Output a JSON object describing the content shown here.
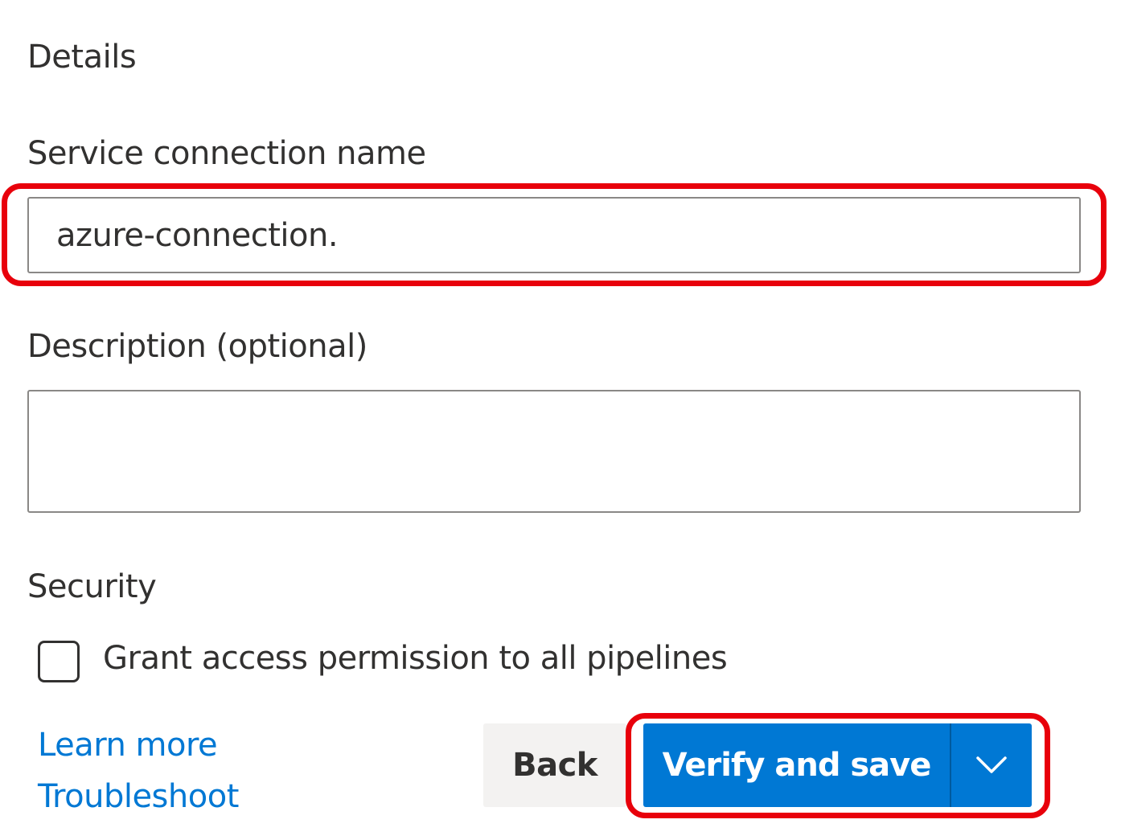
{
  "details": {
    "heading": "Details",
    "name_label": "Service connection name",
    "name_value": "azure-connection.",
    "description_label": "Description (optional)",
    "description_value": ""
  },
  "security": {
    "heading": "Security",
    "grant_access_label": "Grant access permission to all pipelines",
    "grant_access_checked": false
  },
  "links": {
    "learn_more": "Learn more",
    "troubleshoot": "Troubleshoot"
  },
  "actions": {
    "back_label": "Back",
    "verify_save_label": "Verify and save",
    "dropdown_icon": "chevron-down-icon"
  },
  "colors": {
    "primary": "#0078d4",
    "link": "#0078d4",
    "highlight": "#e8000b",
    "secondary_button_bg": "#f3f2f1"
  }
}
